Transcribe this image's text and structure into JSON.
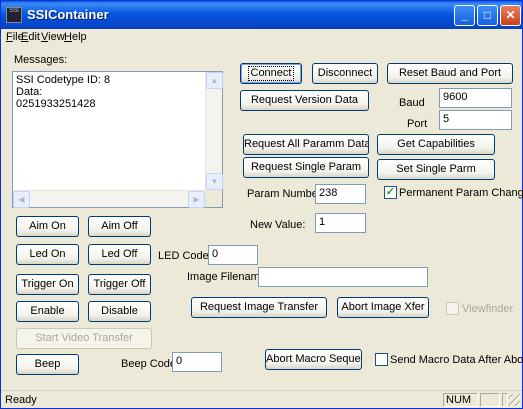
{
  "window": {
    "title": "SSIContainer",
    "icon": "app-icon",
    "controls": {
      "minimize": "_",
      "maximize": "□",
      "close": "✕"
    }
  },
  "menu": [
    {
      "ul": "F",
      "rest": "ile"
    },
    {
      "ul": "E",
      "rest": "dit"
    },
    {
      "ul": "V",
      "rest": "iew"
    },
    {
      "ul": "H",
      "rest": "elp"
    }
  ],
  "messages": {
    "label": "Messages:",
    "lines": "SSI Codetype ID: 8\nData:\n0251933251428"
  },
  "buttons": {
    "connect": "Connect",
    "disconnect": "Disconnect",
    "reset_baud_port": "Reset Baud and Port",
    "request_version": "Request Version Data",
    "request_all_param": "Request All Paramm Data",
    "get_capabilities": "Get Capabilities",
    "request_single_param": "Request Single Param",
    "set_single_parm": "Set Single Parm",
    "aim_on": "Aim On",
    "aim_off": "Aim Off",
    "led_on": "Led On",
    "led_off": "Led Off",
    "trigger_on": "Trigger On",
    "trigger_off": "Trigger Off",
    "enable": "Enable",
    "disable": "Disable",
    "start_video": "Start Video Transfer",
    "request_image": "Request Image Transfer",
    "abort_image": "Abort Image Xfer",
    "beep": "Beep",
    "abort_macro": "Abort Macro Sequence"
  },
  "fields": {
    "baud_label": "Baud",
    "baud_value": "9600",
    "port_label": "Port",
    "port_value": "5",
    "param_number_label": "Param Number:",
    "param_number_value": "238",
    "new_value_label": "New Value:",
    "new_value_value": "1",
    "led_code_label": "LED Code:",
    "led_code_value": "0",
    "image_filename_label": "Image Filename:",
    "image_filename_value": "",
    "beep_code_label": "Beep Code:",
    "beep_code_value": "0"
  },
  "checkboxes": {
    "permanent_param_change": {
      "label": "Permanent Param Change",
      "checked": true,
      "mark": "✓"
    },
    "viewfinder": {
      "label": "Viewfinder",
      "checked": false,
      "mark": ""
    },
    "send_macro_data": {
      "label": "Send Macro Data After Abort",
      "checked": false,
      "mark": ""
    }
  },
  "status": {
    "text": "Ready",
    "num": "NUM"
  }
}
